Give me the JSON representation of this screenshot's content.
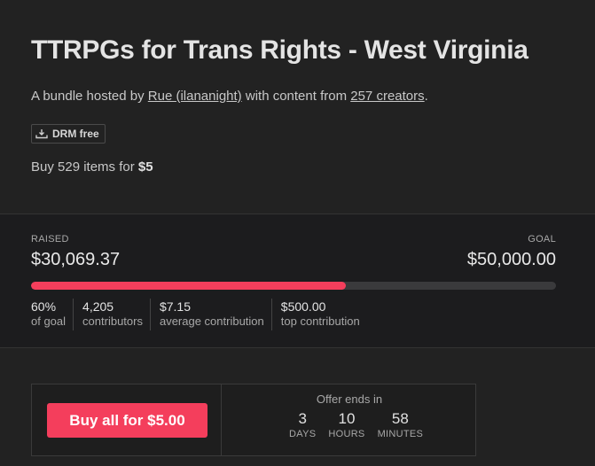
{
  "header": {
    "title": "TTRPGs for Trans Rights - West Virginia",
    "subline_prefix": "A bundle hosted by ",
    "host_link": "Rue (ilananight)",
    "subline_middle": " with content from ",
    "creators_link": "257 creators",
    "subline_suffix": ".",
    "drm_badge": "DRM free",
    "buy_prefix": "Buy 529 items for ",
    "buy_price": "$5"
  },
  "stats": {
    "raised_label": "RAISED",
    "raised_amount": "$30,069.37",
    "goal_label": "GOAL",
    "goal_amount": "$50,000.00",
    "progress_fraction": 0.6,
    "metrics": [
      {
        "value": "60%",
        "label": "of goal"
      },
      {
        "value": "4,205",
        "label": "contributors"
      },
      {
        "value": "$7.15",
        "label": "average contribution"
      },
      {
        "value": "$500.00",
        "label": "top contribution"
      }
    ]
  },
  "purchase": {
    "buy_button": "Buy all for $5.00",
    "offer_label": "Offer ends in",
    "countdown": [
      {
        "num": "3",
        "unit": "DAYS"
      },
      {
        "num": "10",
        "unit": "HOURS"
      },
      {
        "num": "58",
        "unit": "MINUTES"
      }
    ]
  },
  "colors": {
    "accent": "#f43e5c",
    "background": "#222222",
    "panel": "#1c1c1e"
  },
  "icons": {
    "drm": "download-tray-icon"
  }
}
